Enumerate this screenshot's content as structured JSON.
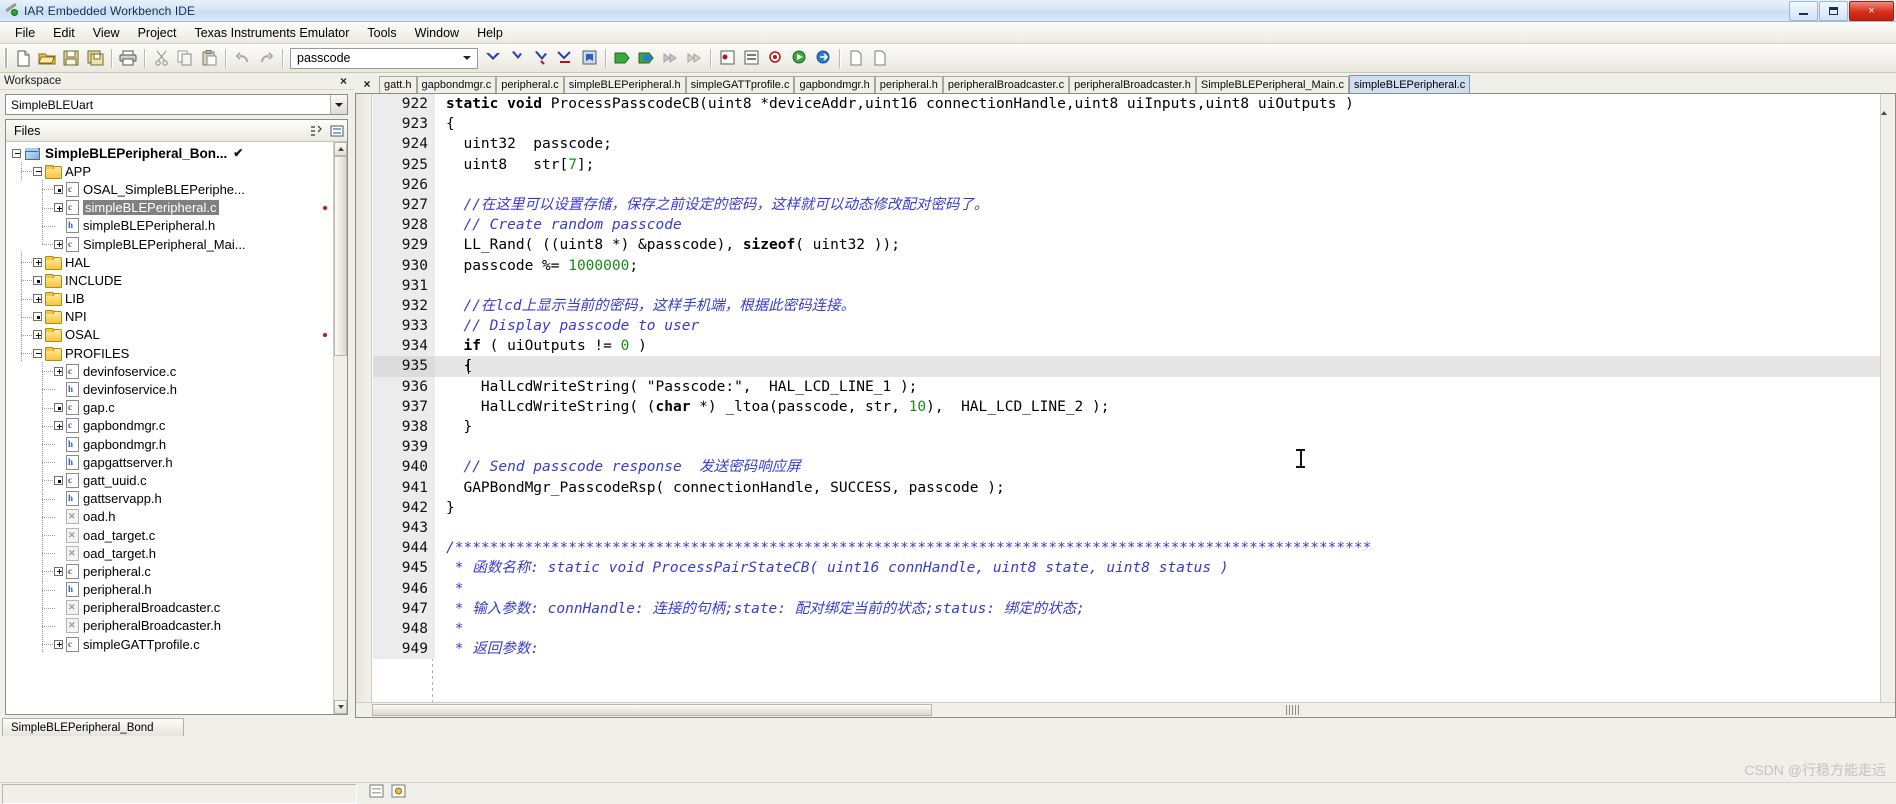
{
  "window": {
    "title": "IAR Embedded Workbench IDE",
    "icon": "wrench-icon",
    "minimize": "minimize-icon",
    "maximize": "maximize-icon",
    "close": "×"
  },
  "menu": {
    "items": [
      "File",
      "Edit",
      "View",
      "Project",
      "Texas Instruments Emulator",
      "Tools",
      "Window",
      "Help"
    ]
  },
  "toolbar": {
    "search_value": "passcode",
    "buttons": [
      "new-document-icon",
      "open-folder-icon",
      "save-icon",
      "save-all-icon",
      "print-icon",
      "cut-icon",
      "copy-icon",
      "paste-icon",
      "undo-icon",
      "redo-icon"
    ],
    "nav_buttons": [
      "navigate-back-icon",
      "navigate-forward-icon",
      "go-to-definition-icon",
      "find-next-icon",
      "bookmark-icon",
      "compile-icon",
      "make-icon",
      "stop-build-icon",
      "debug-icon",
      "breakpoint-toggle-icon",
      "breakpoints-icon",
      "quick-watch-icon",
      "stop-debug-icon",
      "download-debug-icon",
      "run-icon",
      "step-icon"
    ]
  },
  "workspace": {
    "panel_title": "Workspace",
    "close_label": "×",
    "selected_config": "SimpleBLEUart",
    "files_header": "Files",
    "header_icons": [
      "column-settings-icon",
      "overview-icon"
    ],
    "tree": [
      {
        "label": "SimpleBLEPeripheral_Bon...",
        "indent": 0,
        "icon": "project-cube-icon",
        "toggle": "minus",
        "bold": true,
        "check": "✔",
        "selected": false
      },
      {
        "label": "APP",
        "indent": 1,
        "icon": "folder-icon",
        "toggle": "minus",
        "bold": false,
        "selected": false
      },
      {
        "label": "OSAL_SimpleBLEPeriphe...",
        "indent": 2,
        "icon": "c-file-icon",
        "toggle": "dot",
        "bold": false,
        "selected": false
      },
      {
        "label": "simpleBLEPeripheral.c",
        "indent": 2,
        "icon": "c-file-icon",
        "toggle": "plus",
        "bold": false,
        "selected": true,
        "red_dot": true
      },
      {
        "label": "simpleBLEPeripheral.h",
        "indent": 2,
        "icon": "h-file-icon",
        "toggle": "none",
        "bold": false,
        "selected": false
      },
      {
        "label": "SimpleBLEPeripheral_Mai...",
        "indent": 2,
        "icon": "c-file-icon",
        "toggle": "plus",
        "bold": false,
        "selected": false,
        "last": true
      },
      {
        "label": "HAL",
        "indent": 1,
        "icon": "folder-icon",
        "toggle": "plus",
        "bold": false,
        "selected": false
      },
      {
        "label": "INCLUDE",
        "indent": 1,
        "icon": "folder-icon",
        "toggle": "dot",
        "bold": false,
        "selected": false
      },
      {
        "label": "LIB",
        "indent": 1,
        "icon": "folder-icon",
        "toggle": "plus",
        "bold": false,
        "selected": false
      },
      {
        "label": "NPI",
        "indent": 1,
        "icon": "folder-icon",
        "toggle": "dot",
        "bold": false,
        "selected": false
      },
      {
        "label": "OSAL",
        "indent": 1,
        "icon": "folder-icon",
        "toggle": "plus",
        "bold": false,
        "selected": false,
        "red_dot": true
      },
      {
        "label": "PROFILES",
        "indent": 1,
        "icon": "folder-icon",
        "toggle": "minus",
        "bold": false,
        "selected": false
      },
      {
        "label": "devinfoservice.c",
        "indent": 2,
        "icon": "c-file-icon",
        "toggle": "plus",
        "bold": false,
        "selected": false
      },
      {
        "label": "devinfoservice.h",
        "indent": 2,
        "icon": "h-file-icon",
        "toggle": "none",
        "bold": false,
        "selected": false
      },
      {
        "label": "gap.c",
        "indent": 2,
        "icon": "c-file-icon",
        "toggle": "dot",
        "bold": false,
        "selected": false
      },
      {
        "label": "gapbondmgr.c",
        "indent": 2,
        "icon": "c-file-icon",
        "toggle": "plus",
        "bold": false,
        "selected": false
      },
      {
        "label": "gapbondmgr.h",
        "indent": 2,
        "icon": "h-file-icon",
        "toggle": "none",
        "bold": false,
        "selected": false
      },
      {
        "label": "gapgattserver.h",
        "indent": 2,
        "icon": "h-file-icon",
        "toggle": "none",
        "bold": false,
        "selected": false
      },
      {
        "label": "gatt_uuid.c",
        "indent": 2,
        "icon": "c-file-icon",
        "toggle": "dot",
        "bold": false,
        "selected": false
      },
      {
        "label": "gattservapp.h",
        "indent": 2,
        "icon": "h-file-icon",
        "toggle": "none",
        "bold": false,
        "selected": false
      },
      {
        "label": "oad.h",
        "indent": 2,
        "icon": "excluded-file-icon",
        "toggle": "none",
        "bold": false,
        "selected": false
      },
      {
        "label": "oad_target.c",
        "indent": 2,
        "icon": "excluded-file-icon",
        "toggle": "none",
        "bold": false,
        "selected": false
      },
      {
        "label": "oad_target.h",
        "indent": 2,
        "icon": "excluded-file-icon",
        "toggle": "none",
        "bold": false,
        "selected": false
      },
      {
        "label": "peripheral.c",
        "indent": 2,
        "icon": "c-file-icon",
        "toggle": "plus",
        "bold": false,
        "selected": false
      },
      {
        "label": "peripheral.h",
        "indent": 2,
        "icon": "h-file-icon",
        "toggle": "none",
        "bold": false,
        "selected": false
      },
      {
        "label": "peripheralBroadcaster.c",
        "indent": 2,
        "icon": "excluded-file-icon",
        "toggle": "none",
        "bold": false,
        "selected": false
      },
      {
        "label": "peripheralBroadcaster.h",
        "indent": 2,
        "icon": "excluded-file-icon",
        "toggle": "none",
        "bold": false,
        "selected": false
      },
      {
        "label": "simpleGATTprofile.c",
        "indent": 2,
        "icon": "c-file-icon",
        "toggle": "plus",
        "bold": false,
        "selected": false
      }
    ],
    "bottom_tab": "SimpleBLEPeripheral_Bond"
  },
  "editor": {
    "tabs": [
      {
        "label": "gatt.h",
        "active": false
      },
      {
        "label": "gapbondmgr.c",
        "active": false
      },
      {
        "label": "peripheral.c",
        "active": false
      },
      {
        "label": "simpleBLEPeripheral.h",
        "active": false
      },
      {
        "label": "simpleGATTprofile.c",
        "active": false
      },
      {
        "label": "gapbondmgr.h",
        "active": false
      },
      {
        "label": "peripheral.h",
        "active": false
      },
      {
        "label": "peripheralBroadcaster.c",
        "active": false
      },
      {
        "label": "peripheralBroadcaster.h",
        "active": false
      },
      {
        "label": "SimpleBLEPeripheral_Main.c",
        "active": false
      },
      {
        "label": "simpleBLEPeripheral.c",
        "active": true
      }
    ],
    "close_tab_label": "×",
    "current_line": 935,
    "lines": [
      {
        "n": 922,
        "html": "<span class=\"kw\">static void</span> ProcessPasscodeCB(uint8 *deviceAddr,uint16 connectionHandle,uint8 uiInputs,uint8 uiOutputs )"
      },
      {
        "n": 923,
        "html": "{"
      },
      {
        "n": 924,
        "html": "  uint32  passcode;"
      },
      {
        "n": 925,
        "html": "  uint8   str[<span class=\"num\">7</span>];"
      },
      {
        "n": 926,
        "html": ""
      },
      {
        "n": 927,
        "html": "  <span class=\"cmt\">//在这里可以设置存储，保存之前设定的密码，这样就可以动态修改配对密码了。</span>"
      },
      {
        "n": 928,
        "html": "  <span class=\"cmt\">// Create random passcode</span>"
      },
      {
        "n": 929,
        "html": "  LL_Rand( ((uint8 *) &amp;passcode), <span class=\"kw\">sizeof</span>( uint32 ));"
      },
      {
        "n": 930,
        "html": "  passcode %= <span class=\"num\">1000000</span>;"
      },
      {
        "n": 931,
        "html": ""
      },
      {
        "n": 932,
        "html": "  <span class=\"cmt\">//在lcd上显示当前的密码，这样手机端，根据此密码连接。</span>"
      },
      {
        "n": 933,
        "html": "  <span class=\"cmt\">// Display passcode to user</span>"
      },
      {
        "n": 934,
        "html": "  <span class=\"kw\">if</span> ( uiOutputs != <span class=\"num\">0</span> )"
      },
      {
        "n": 935,
        "html": "  {"
      },
      {
        "n": 936,
        "html": "    HalLcdWriteString( \"Passcode:\",  HAL_LCD_LINE_1 );"
      },
      {
        "n": 937,
        "html": "    HalLcdWriteString( (<span class=\"kw\">char</span> *) _ltoa(passcode, str, <span class=\"num\">10</span>),  HAL_LCD_LINE_2 );"
      },
      {
        "n": 938,
        "html": "  }"
      },
      {
        "n": 939,
        "html": ""
      },
      {
        "n": 940,
        "html": "  <span class=\"cmt\">// Send passcode response  发送密码响应屏</span>"
      },
      {
        "n": 941,
        "html": "  GAPBondMgr_PasscodeRsp( connectionHandle, SUCCESS, passcode );"
      },
      {
        "n": 942,
        "html": "}"
      },
      {
        "n": 943,
        "html": ""
      },
      {
        "n": 944,
        "html": "<span class=\"cmt\">/*********************************************************************************************************</span>"
      },
      {
        "n": 945,
        "html": "<span class=\"cmt\"> * 函数名称: static void ProcessPairStateCB( uint16 connHandle, uint8 state, uint8 status )</span>"
      },
      {
        "n": 946,
        "html": "<span class=\"cmt\"> *</span>"
      },
      {
        "n": 947,
        "html": "<span class=\"cmt\"> * 输入参数: connHandle: 连接的句柄;state: 配对绑定当前的状态;status: 绑定的状态;</span>"
      },
      {
        "n": 948,
        "html": "<span class=\"cmt\"> *</span>"
      },
      {
        "n": 949,
        "html": "<span class=\"cmt\"> * 返回参数:</span>"
      }
    ]
  },
  "statusbar": {
    "left_text": "",
    "icons": [
      "errors-icon",
      "warnings-icon"
    ]
  },
  "watermark": "CSDN @行稳方能走远",
  "colors": {
    "comment": "#3a3ad0",
    "number": "#1a8a1a",
    "selection": "#808080",
    "active_tab": "#cfdff0",
    "titlebar_close": "#d72d1b"
  }
}
